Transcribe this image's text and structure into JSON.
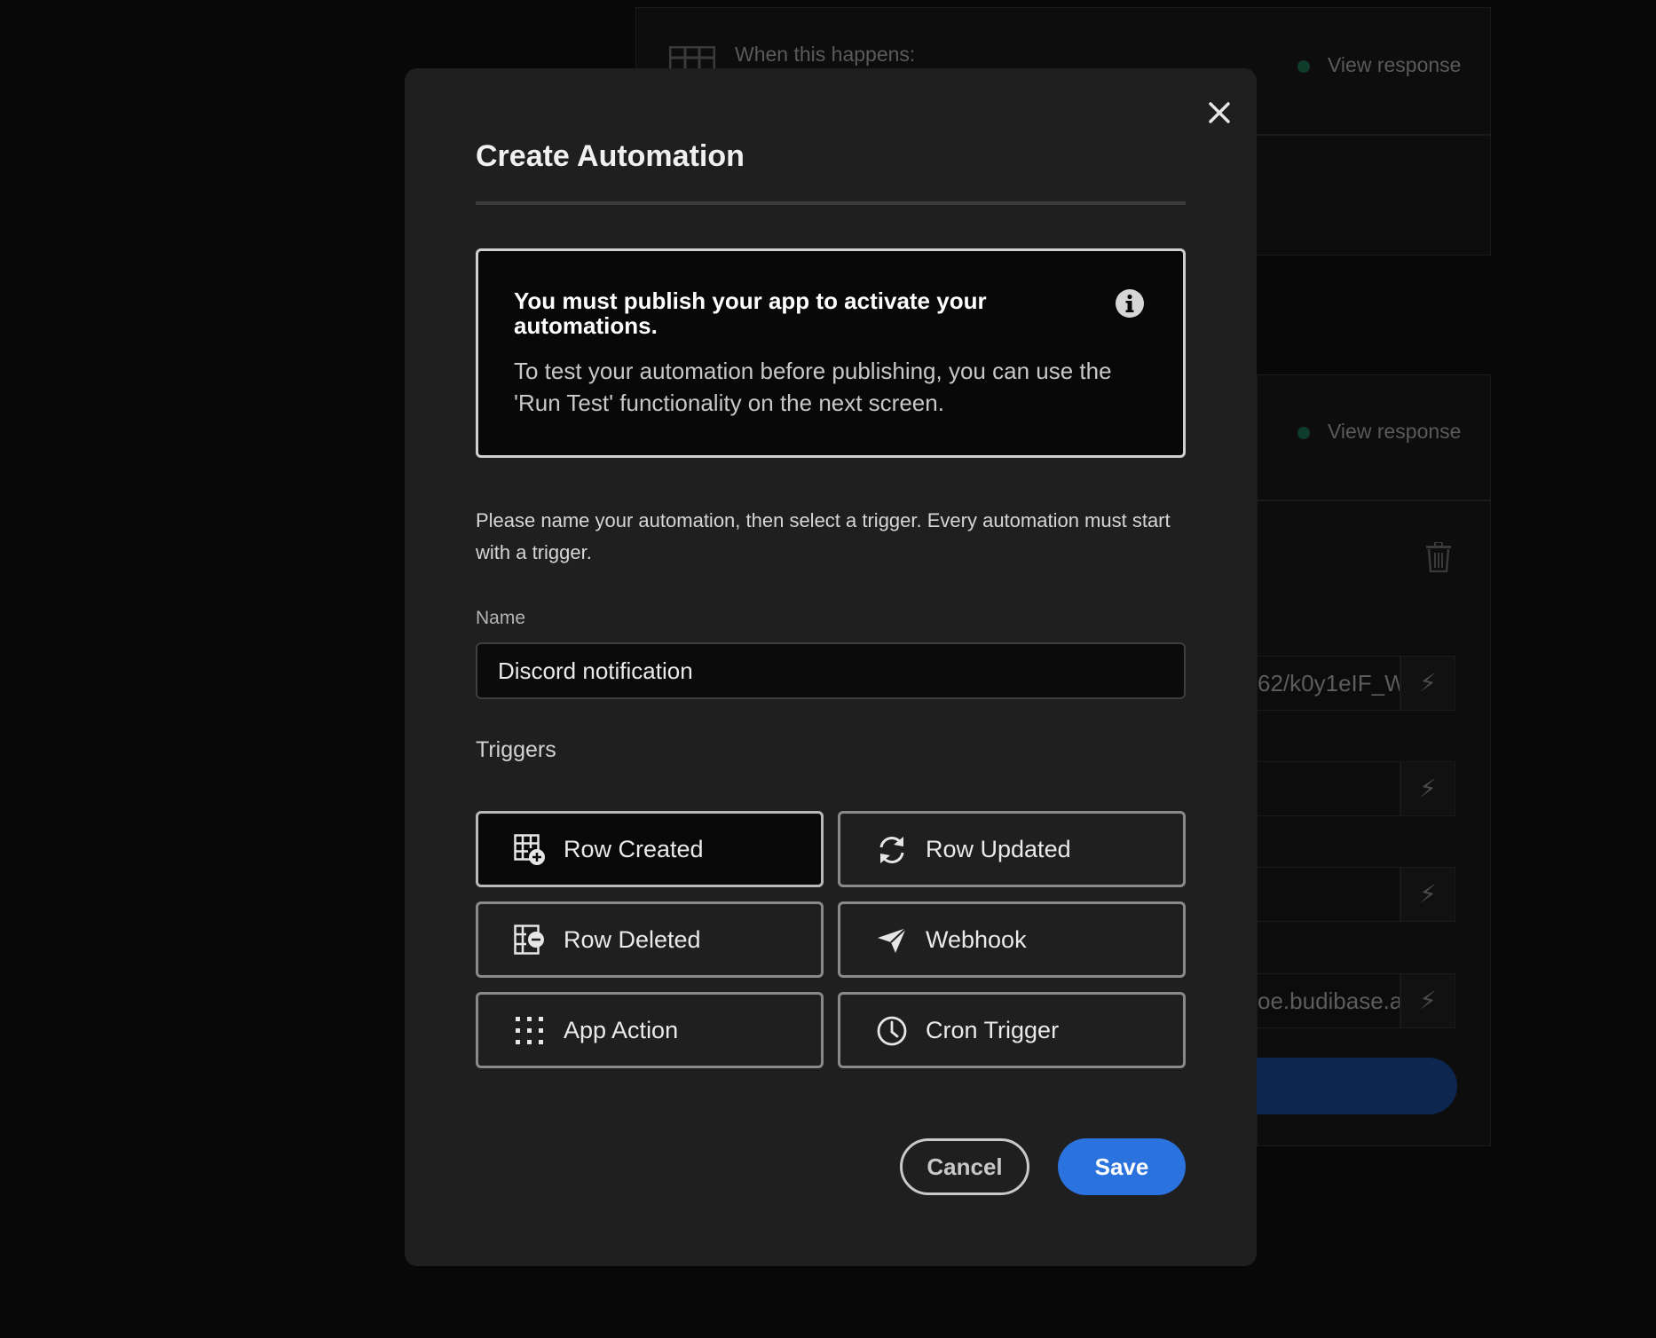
{
  "background": {
    "trigger_heading": "When this happens:",
    "view_response_1": "View response",
    "view_response_2": "View response",
    "field_1_value": "62/k0y1eIF_W",
    "field_4_value": "oe.budibase.a",
    "status_dot_color": "#0f3b2a",
    "icons": [
      "table-icon",
      "trash-icon",
      "lightning-icon"
    ]
  },
  "modal": {
    "title": "Create Automation",
    "close_icon": "close-icon",
    "notice": {
      "title": "You must publish your app to activate your automations.",
      "body": "To test your automation before publishing, you can use the 'Run Test' functionality on the next screen.",
      "icon": "info-icon"
    },
    "description": "Please name your automation, then select a trigger. Every automation must start with a trigger.",
    "name_field": {
      "label": "Name",
      "value": "Discord notification"
    },
    "triggers_label": "Triggers",
    "triggers": [
      {
        "label": "Row Created",
        "icon": "row-created-icon",
        "selected": true
      },
      {
        "label": "Row Updated",
        "icon": "refresh-icon",
        "selected": false
      },
      {
        "label": "Row Deleted",
        "icon": "row-deleted-icon",
        "selected": false
      },
      {
        "label": "Webhook",
        "icon": "send-icon",
        "selected": false
      },
      {
        "label": "App Action",
        "icon": "grid-dots-icon",
        "selected": false
      },
      {
        "label": "Cron Trigger",
        "icon": "clock-icon",
        "selected": false
      }
    ],
    "cancel_label": "Cancel",
    "save_label": "Save",
    "accent_color": "#2a72de"
  }
}
